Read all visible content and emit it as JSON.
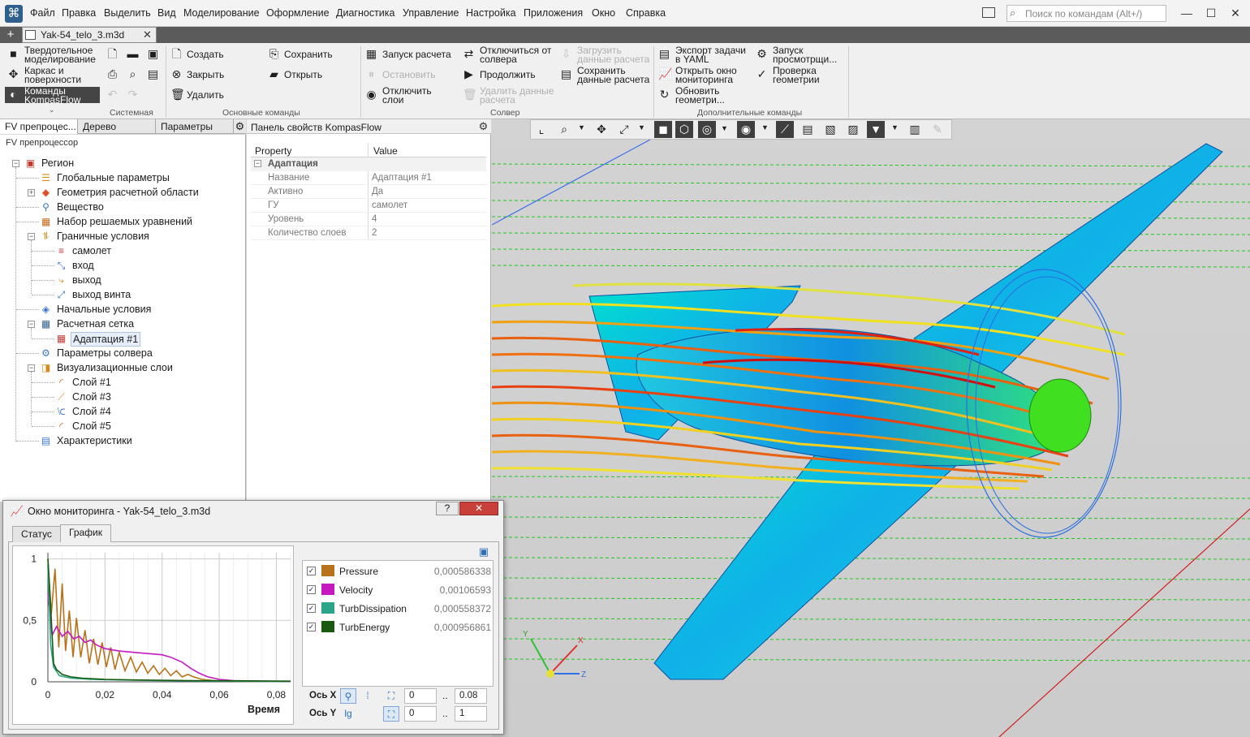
{
  "menu": {
    "items": [
      "Файл",
      "Правка",
      "Выделить",
      "Вид",
      "Моделирование",
      "Оформление",
      "Диагностика",
      "Управление",
      "Настройка",
      "Приложения",
      "Окно",
      "Справка"
    ],
    "search_placeholder": "Поиск по командам (Alt+/)"
  },
  "tabbar": {
    "doc_tab": "Yak-54_telo_3.m3d"
  },
  "ribbon": {
    "modes": [
      {
        "line1": "Твердотельное",
        "line2": "моделирование"
      },
      {
        "line1": "Каркас и",
        "line2": "поверхности"
      },
      {
        "line1": "Команды",
        "line2": "KompasFlow"
      }
    ],
    "main_commands": {
      "create": "Создать",
      "close": "Закрыть",
      "delete": "Удалить",
      "save": "Сохранить",
      "open": "Открыть"
    },
    "solver": {
      "run": "Запуск расчета",
      "stop": "Остановить",
      "disable_layers": {
        "line1": "Отключить",
        "line2": "слои"
      },
      "disconnect": {
        "line1": "Отключиться от",
        "line2": "солвера"
      },
      "continue": "Продолжить",
      "load": {
        "line1": "Загрузить",
        "line2": "данные расчета"
      },
      "save": {
        "line1": "Сохранить",
        "line2": "данные расчета"
      },
      "delete": {
        "line1": "Удалить данные",
        "line2": "расчета"
      }
    },
    "extra": {
      "export": {
        "line1": "Экспорт задачи",
        "line2": "в YAML"
      },
      "open_monitor": {
        "line1": "Открыть окно",
        "line2": "мониторинга"
      },
      "update_geom": {
        "line1": "Обновить",
        "line2": "геометри..."
      },
      "launch_viewer": {
        "line1": "Запуск",
        "line2": "просмотрщи..."
      },
      "check_geom": {
        "line1": "Проверка",
        "line2": "геометрии"
      }
    },
    "groups": {
      "system": "Системная",
      "main": "Основные команды",
      "solver": "Солвер",
      "extra": "Дополнительные команды"
    }
  },
  "left_panel": {
    "tabs": [
      "FV препроцес...",
      "Дерево",
      "Параметры"
    ],
    "title": "FV препроцессор",
    "tree": [
      {
        "label": "Регион"
      },
      {
        "label": "Глобальные параметры"
      },
      {
        "label": "Геометрия расчетной области"
      },
      {
        "label": "Вещество"
      },
      {
        "label": "Набор решаемых уравнений"
      },
      {
        "label": "Граничные условия"
      },
      {
        "label": "самолет"
      },
      {
        "label": "вход"
      },
      {
        "label": "выход"
      },
      {
        "label": "выход винта"
      },
      {
        "label": "Начальные условия"
      },
      {
        "label": "Расчетная сетка"
      },
      {
        "label": "Адаптация #1"
      },
      {
        "label": "Параметры солвера"
      },
      {
        "label": "Визуализационные слои"
      },
      {
        "label": "Слой #1"
      },
      {
        "label": "Слой #3"
      },
      {
        "label": "Слой #4"
      },
      {
        "label": "Слой #5"
      },
      {
        "label": "Характеристики"
      }
    ]
  },
  "props": {
    "title": "Панель свойств KompasFlow",
    "col_property": "Property",
    "col_value": "Value",
    "section": "Адаптация",
    "rows": [
      {
        "k": "Название",
        "v": "Адаптация #1"
      },
      {
        "k": "Активно",
        "v": "Да"
      },
      {
        "k": "ГУ",
        "v": "самолет"
      },
      {
        "k": "Уровень",
        "v": "4"
      },
      {
        "k": "Количество слоев",
        "v": "2"
      }
    ]
  },
  "viewport": {
    "axis_x": "X",
    "axis_y": "Y",
    "axis_z": "Z"
  },
  "monitor": {
    "title": "Окно мониторинга - Yak-54_telo_3.m3d",
    "help": "?",
    "close": "✕",
    "tabs": [
      "Статус",
      "График"
    ],
    "axis_x_label": "Ось X",
    "axis_y_label": "Ось Y",
    "x_min": "0",
    "x_max": "0.08",
    "y_min": "0",
    "y_max": "1",
    "series": [
      {
        "name": "Pressure",
        "color": "#b8731a",
        "value": "0,000586338"
      },
      {
        "name": "Velocity",
        "color": "#c718c0",
        "value": "0,00106593"
      },
      {
        "name": "TurbDissipation",
        "color": "#2aa58a",
        "value": "0,000558372"
      },
      {
        "name": "TurbEnergy",
        "color": "#1a5a10",
        "value": "0,000956861"
      }
    ]
  },
  "chart_data": {
    "type": "line",
    "xlabel": "Время",
    "ylabel": "",
    "xlim": [
      0,
      0.085
    ],
    "ylim": [
      0,
      1.05
    ],
    "x_ticks": [
      "0",
      "0,02",
      "0,04",
      "0,06",
      "0,08"
    ],
    "y_ticks": [
      "0",
      "0,5",
      "1"
    ],
    "x_tick_values": [
      0,
      0.02,
      0.04,
      0.06,
      0.08
    ],
    "y_tick_values": [
      0,
      0.5,
      1
    ],
    "grid": true,
    "series": [
      {
        "name": "Pressure",
        "color": "#b8731a",
        "x": [
          0,
          0.0012,
          0.0025,
          0.0038,
          0.005,
          0.0062,
          0.0075,
          0.0088,
          0.01,
          0.0115,
          0.013,
          0.0145,
          0.016,
          0.0175,
          0.019,
          0.0205,
          0.022,
          0.0235,
          0.025,
          0.027,
          0.029,
          0.031,
          0.033,
          0.035,
          0.037,
          0.039,
          0.041,
          0.043,
          0.045,
          0.047,
          0.049,
          0.051,
          0.054,
          0.058,
          0.062,
          0.07,
          0.085
        ],
        "y": [
          1.0,
          0.55,
          0.92,
          0.28,
          0.8,
          0.25,
          0.58,
          0.2,
          0.52,
          0.2,
          0.42,
          0.15,
          0.35,
          0.14,
          0.32,
          0.12,
          0.28,
          0.1,
          0.24,
          0.09,
          0.2,
          0.08,
          0.16,
          0.07,
          0.13,
          0.06,
          0.11,
          0.05,
          0.09,
          0.04,
          0.06,
          0.04,
          0.02,
          0.01,
          0.006,
          0.003,
          0.001
        ]
      },
      {
        "name": "Velocity",
        "color": "#c718c0",
        "x": [
          0,
          0.0015,
          0.003,
          0.005,
          0.007,
          0.009,
          0.011,
          0.013,
          0.015,
          0.017,
          0.02,
          0.025,
          0.03,
          0.035,
          0.04,
          0.043,
          0.047,
          0.05,
          0.053,
          0.056,
          0.06,
          0.065,
          0.075,
          0.085
        ],
        "y": [
          0.72,
          0.38,
          0.45,
          0.37,
          0.41,
          0.35,
          0.37,
          0.32,
          0.34,
          0.3,
          0.27,
          0.25,
          0.24,
          0.23,
          0.22,
          0.2,
          0.16,
          0.11,
          0.07,
          0.04,
          0.02,
          0.01,
          0.005,
          0.002
        ]
      },
      {
        "name": "TurbDissipation",
        "color": "#2aa58a",
        "x": [
          0,
          0.001,
          0.002,
          0.004,
          0.008,
          0.015,
          0.025,
          0.04,
          0.06,
          0.085
        ],
        "y": [
          0.95,
          0.3,
          0.12,
          0.05,
          0.03,
          0.02,
          0.015,
          0.01,
          0.005,
          0.002
        ]
      },
      {
        "name": "TurbEnergy",
        "color": "#1a5a10",
        "x": [
          0,
          0.001,
          0.002,
          0.003,
          0.005,
          0.008,
          0.012,
          0.02,
          0.03,
          0.05,
          0.085
        ],
        "y": [
          1.0,
          0.6,
          0.15,
          0.1,
          0.06,
          0.04,
          0.03,
          0.02,
          0.015,
          0.01,
          0.005
        ]
      }
    ]
  },
  "colors": {
    "accent": "#2f5f8d",
    "close_red": "#c9403a"
  }
}
